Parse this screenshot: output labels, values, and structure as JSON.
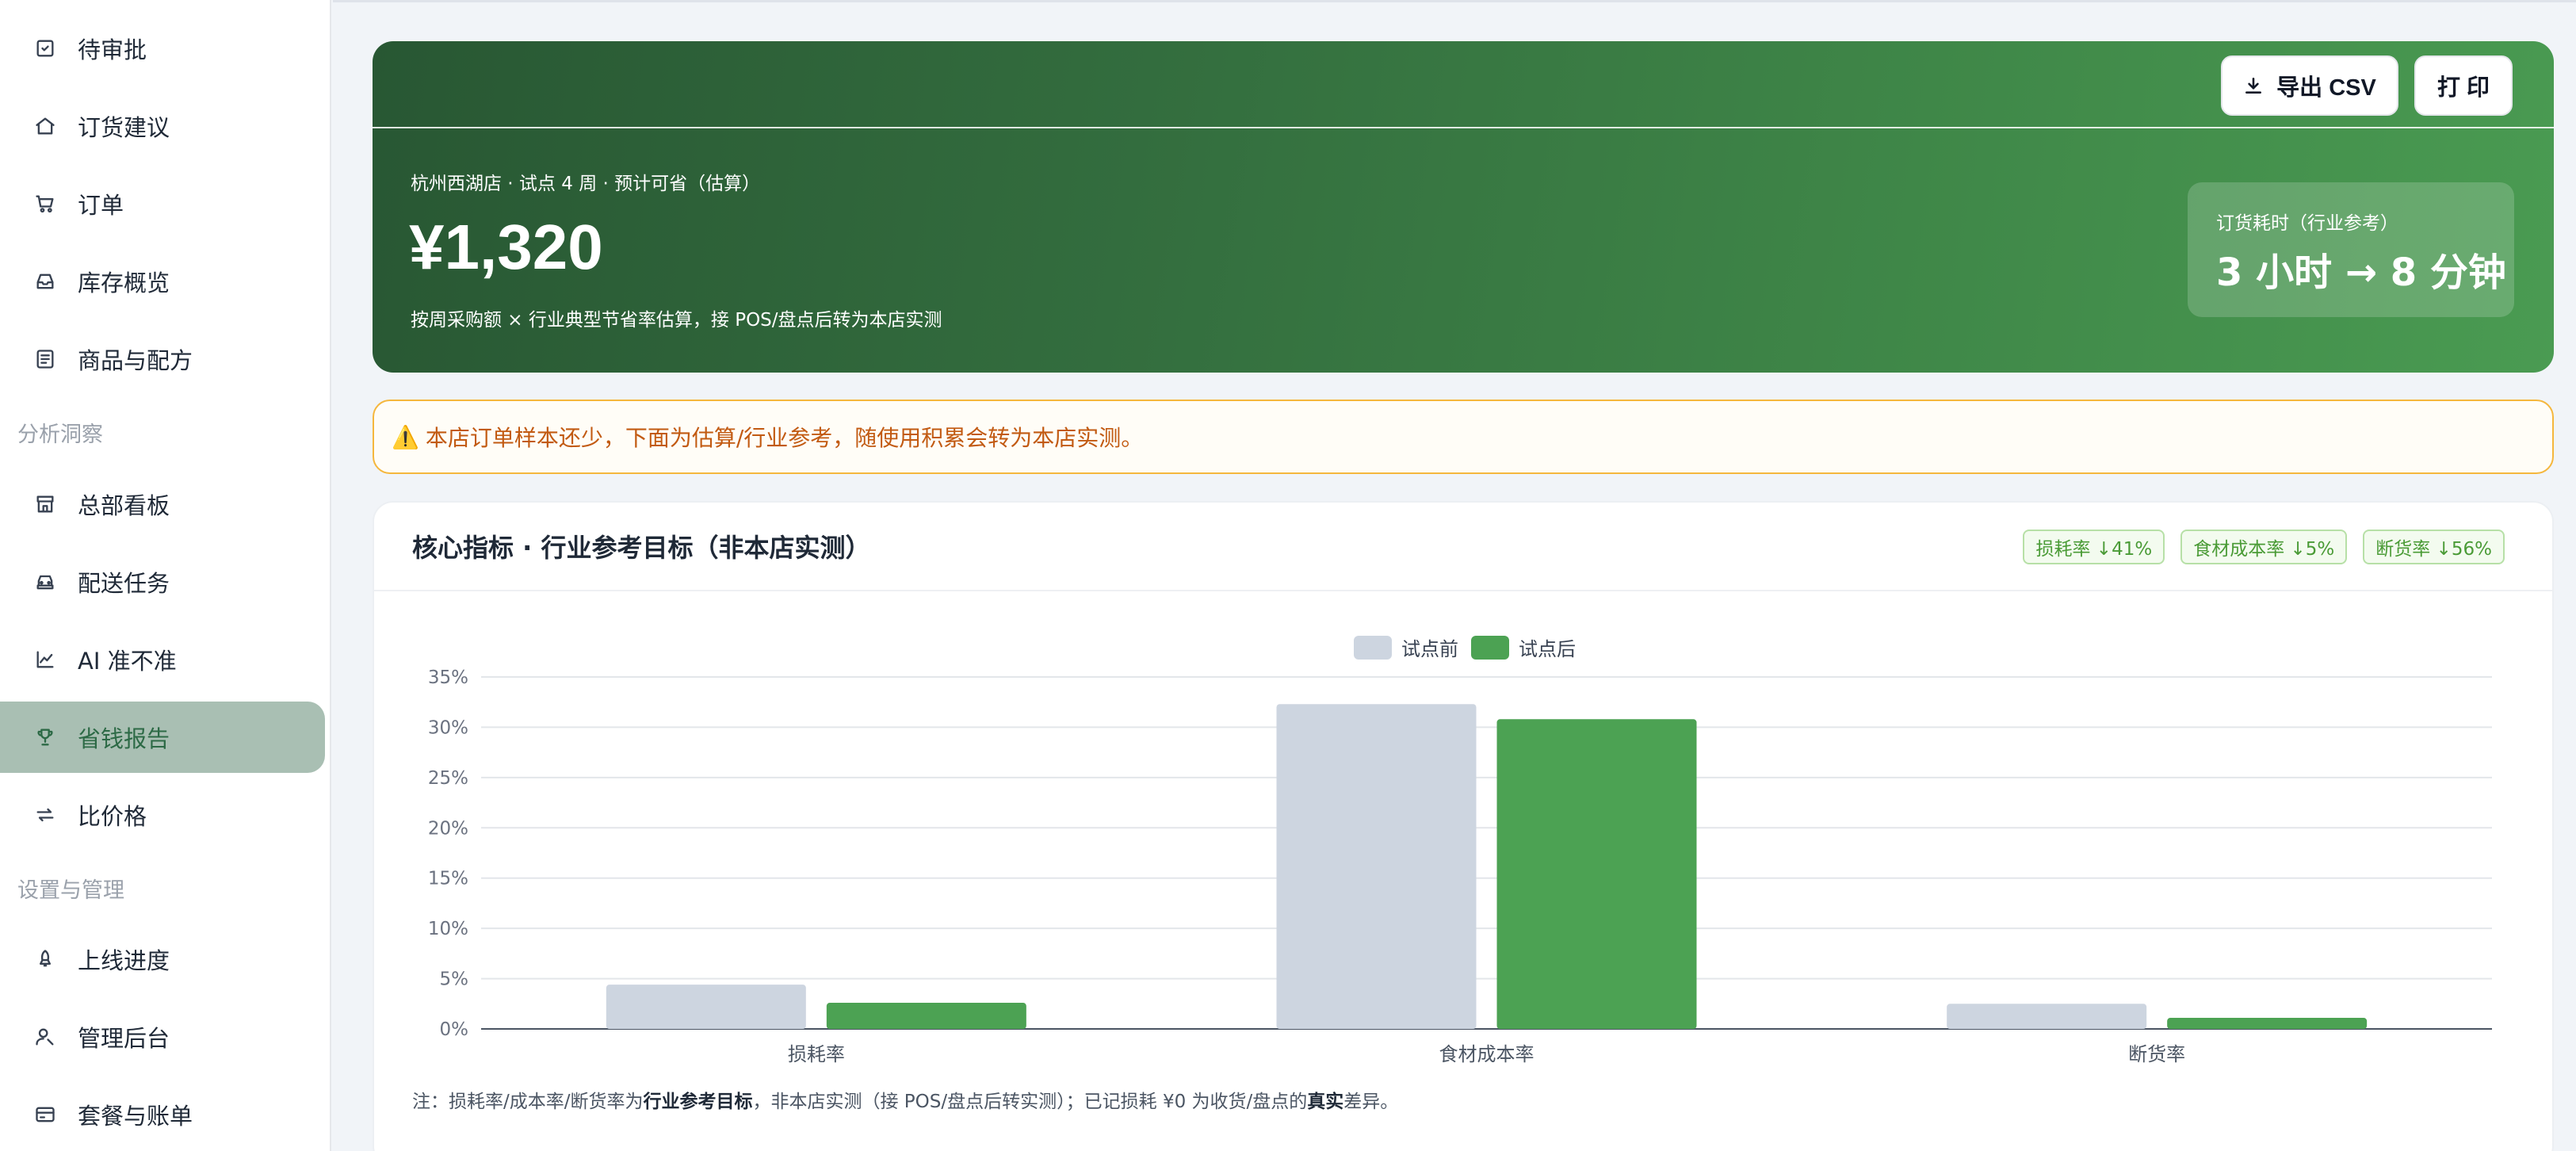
{
  "sidebar": {
    "items": [
      {
        "label": "待审批",
        "icon": "check-square-icon"
      },
      {
        "label": "订货建议",
        "icon": "home-icon"
      },
      {
        "label": "订单",
        "icon": "cart-icon"
      },
      {
        "label": "库存概览",
        "icon": "inbox-icon"
      },
      {
        "label": "商品与配方",
        "icon": "list-icon"
      },
      {
        "label": "总部看板",
        "icon": "store-icon"
      },
      {
        "label": "配送任务",
        "icon": "car-icon"
      },
      {
        "label": "AI 准不准",
        "icon": "line-chart-icon"
      },
      {
        "label": "省钱报告",
        "icon": "trophy-icon",
        "active": true
      },
      {
        "label": "比价格",
        "icon": "swap-icon"
      },
      {
        "label": "上线进度",
        "icon": "rocket-icon"
      },
      {
        "label": "管理后台",
        "icon": "user-cog-icon"
      },
      {
        "label": "套餐与账单",
        "icon": "credit-card-icon"
      }
    ],
    "sections": [
      "分析洞察",
      "设置与管理"
    ]
  },
  "hero": {
    "export_label": "导出 CSV",
    "print_label": "打 印",
    "subtitle": "杭州西湖店 · 试点 4 周 · 预计可省（估算）",
    "amount": "¥1,320",
    "note": "按周采购额 × 行业典型节省率估算，接 POS/盘点后转为本店实测",
    "card_label": "订货耗时（行业参考）",
    "card_value": "3 小时 → 8 分钟"
  },
  "warning": {
    "icon": "⚠️",
    "text": "本店订单样本还少，下面为估算/行业参考，随使用积累会转为本店实测。"
  },
  "panel": {
    "title": "核心指标 · 行业参考目标（非本店实测）",
    "tags": [
      "损耗率 ↓41%",
      "食材成本率 ↓5%",
      "断货率 ↓56%"
    ],
    "footnote_1": "注：损耗率/成本率/断货率为",
    "footnote_b1": "行业参考目标",
    "footnote_2": "，非本店实测（接 POS/盘点后转实测）；已记损耗 ¥0 为收货/盘点的",
    "footnote_b2": "真实",
    "footnote_3": "差异。"
  },
  "chart_data": {
    "type": "bar",
    "categories": [
      "损耗率",
      "食材成本率",
      "断货率"
    ],
    "series": [
      {
        "name": "试点前",
        "values": [
          4.4,
          32.3,
          2.5
        ],
        "color": "#cdd5e0"
      },
      {
        "name": "试点后",
        "values": [
          2.6,
          30.8,
          1.1
        ],
        "color": "#4ca253"
      }
    ],
    "ylim": [
      0,
      35
    ],
    "yticks": [
      "0%",
      "5%",
      "10%",
      "15%",
      "20%",
      "25%",
      "30%",
      "35%"
    ],
    "grid": true,
    "legend": "top-center"
  }
}
